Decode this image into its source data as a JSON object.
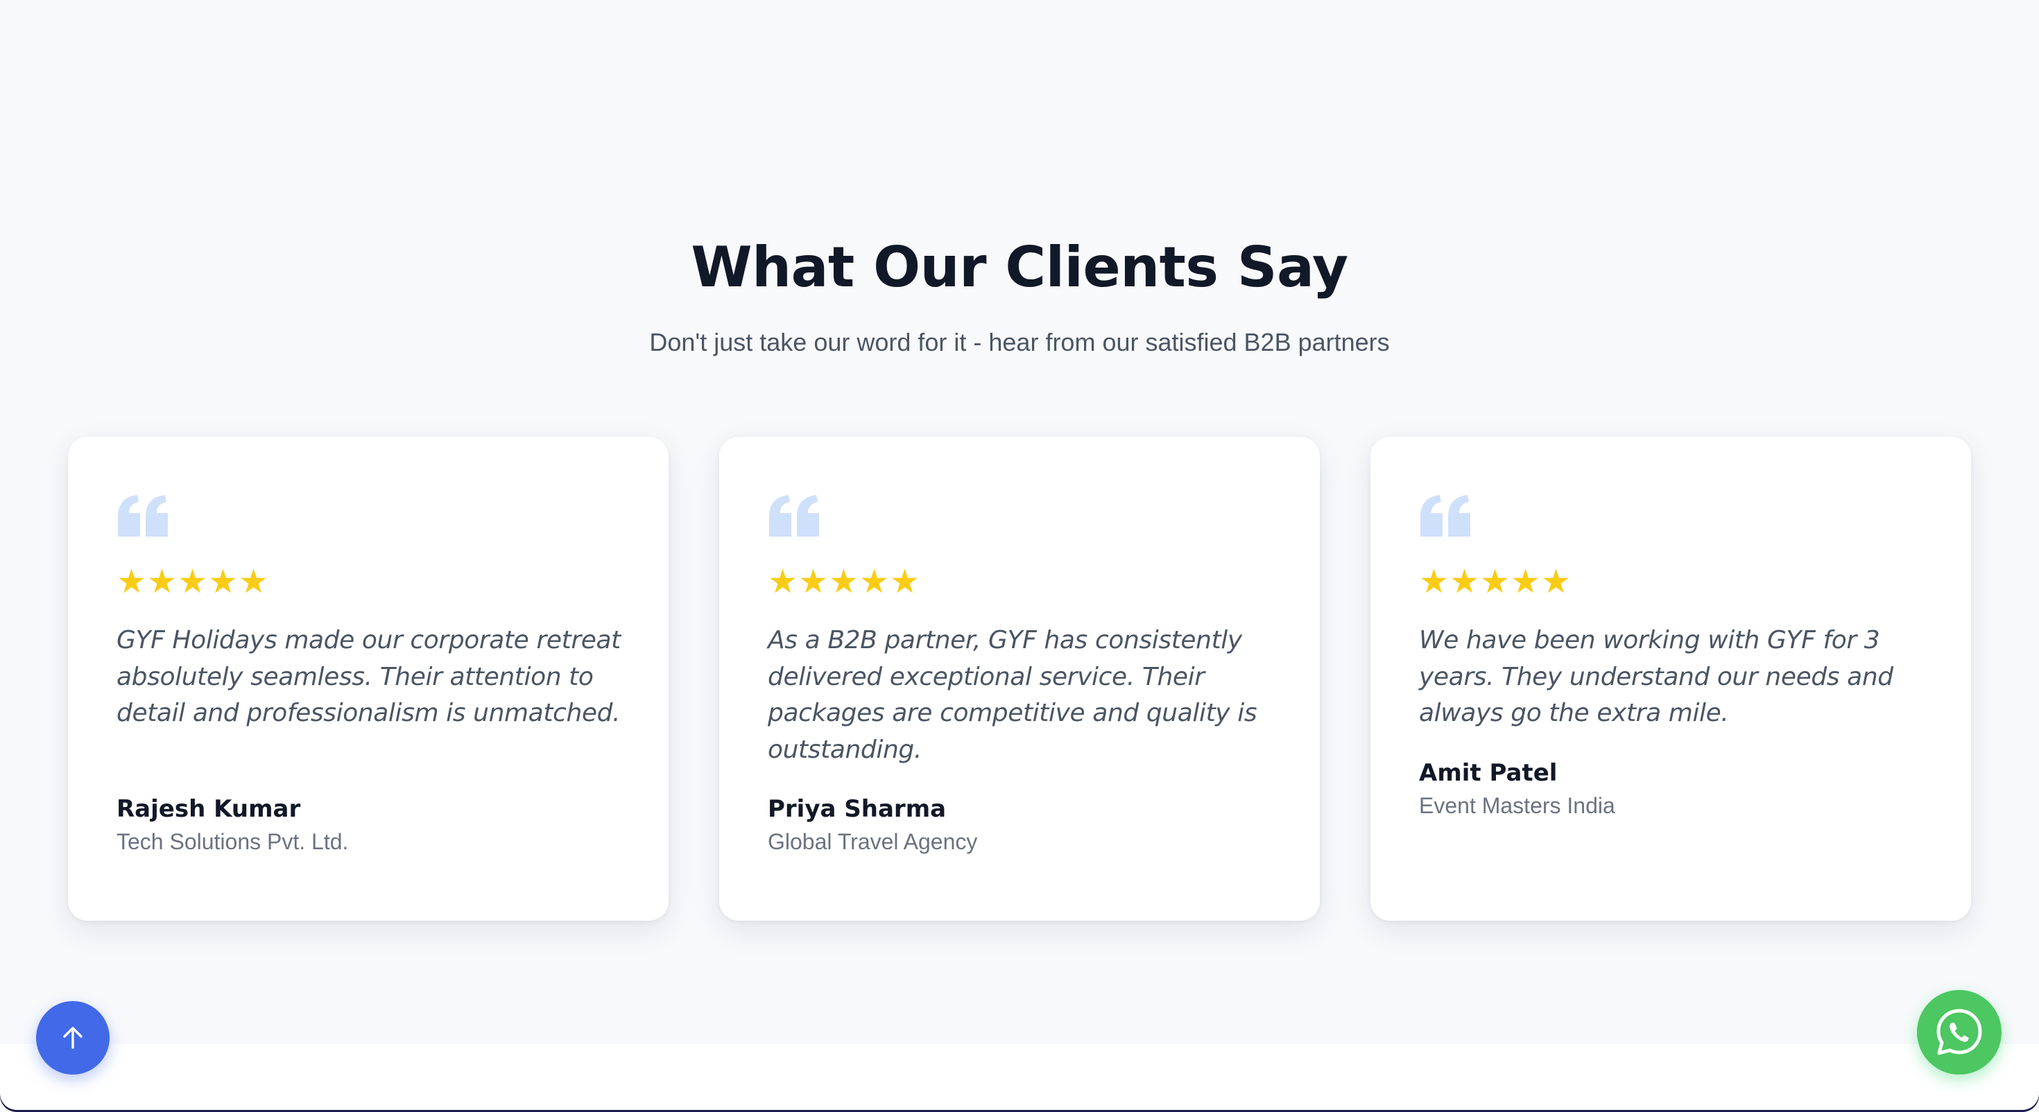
{
  "section": {
    "heading": "What Our Clients Say",
    "subheading": "Don't just take our word for it - hear from our satisfied B2B partners"
  },
  "icons": {
    "quote": "quote-icon",
    "star": "star-icon",
    "scroll_top": "arrow-up-icon",
    "whatsapp": "whatsapp-icon"
  },
  "colors": {
    "star": "#facc15",
    "quote_icon": "#cfe0fb",
    "heading": "#111827",
    "body_text": "#4b5563",
    "muted_text": "#6b7280",
    "scroll_top_button": "#4169e8",
    "whatsapp_button": "#4cc761",
    "background": "#f8f9fb"
  },
  "testimonials": [
    {
      "rating": 5,
      "text": "GYF Holidays made our corporate retreat absolutely seamless. Their attention to detail and professionalism is unmatched.",
      "name": "Rajesh Kumar",
      "company": "Tech Solutions Pvt. Ltd."
    },
    {
      "rating": 5,
      "text": "As a B2B partner, GYF has consistently delivered exceptional service. Their packages are competitive and quality is outstanding.",
      "name": "Priya Sharma",
      "company": "Global Travel Agency"
    },
    {
      "rating": 5,
      "text": "We have been working with GYF for 3 years. They understand our needs and always go the extra mile.",
      "name": "Amit Patel",
      "company": "Event Masters India"
    }
  ]
}
